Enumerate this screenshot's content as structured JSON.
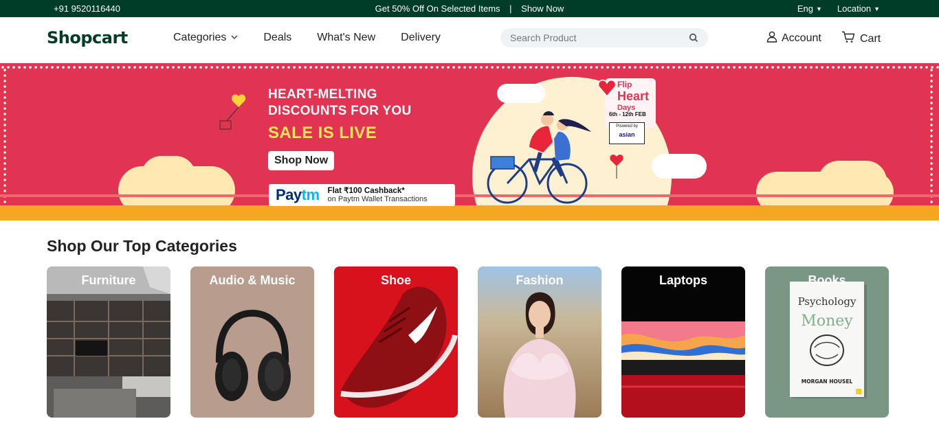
{
  "topbar": {
    "phone": "+91 9520116440",
    "promo": "Get 50% Off On Selected Items",
    "separator": "|",
    "promo_link": "Show Now",
    "language": "Eng",
    "location": "Location"
  },
  "header": {
    "logo": "Shopcart",
    "nav": [
      "Categories",
      "Deals",
      "What's New",
      "Delivery"
    ],
    "search_placeholder": "Search Product",
    "account": "Account",
    "cart": "Cart"
  },
  "banner": {
    "headline_1": "HEART-MELTING",
    "headline_2": "DISCOUNTS FOR YOU",
    "sale": "SALE IS LIVE",
    "cta": "Shop Now",
    "paytm_logo_a": "Pay",
    "paytm_logo_b": "tm",
    "paytm_offer": "Flat ₹100 Cashback*",
    "paytm_sub": "on Paytm Wallet Transactions",
    "flip_1": "Flip",
    "flip_2": "Heart",
    "flip_3": "Days",
    "dates": "6th - 12th FEB",
    "powered_by": "Powered by",
    "sponsor": "asian"
  },
  "categories": {
    "title": "Shop Our Top Categories",
    "items": [
      {
        "label": "Furniture"
      },
      {
        "label": "Audio & Music"
      },
      {
        "label": "Shoe"
      },
      {
        "label": "Fashion"
      },
      {
        "label": "Laptops"
      },
      {
        "label": "Books"
      }
    ]
  },
  "colors": {
    "brand": "#003d29",
    "banner_red": "#e03452",
    "sale_yellow": "#ffe45c"
  }
}
